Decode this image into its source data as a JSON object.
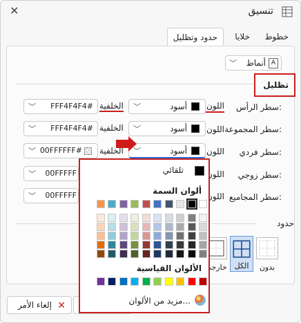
{
  "window": {
    "title": "تنسيق",
    "close": "✕"
  },
  "tabs": [
    {
      "label": "خطوط",
      "active": false
    },
    {
      "label": "خلايا",
      "active": false
    },
    {
      "label": "حدود وتظليل",
      "active": true
    }
  ],
  "styles_button": {
    "label": "أنماط"
  },
  "shading": {
    "title": "تظليل",
    "rows": [
      {
        "label": "سطر الرأس:",
        "color_label": "اللون",
        "color_value": "أسود",
        "bg_label": "الخلفية",
        "bg_value": "FFF4F4F4#"
      },
      {
        "label": "سطر المجموعة:",
        "color_label": "اللون",
        "color_value": "أسود",
        "bg_label": "الخلفية",
        "bg_value": "FFF4F4F4#"
      },
      {
        "label": "سطر فردي:",
        "color_label": "اللون",
        "color_value": "أسود",
        "bg_label": "الخلفية",
        "bg_value": "00FFFFFF#"
      },
      {
        "label": "سطر زوجي:",
        "color_label": "اللون",
        "color_value": "",
        "bg_label": "",
        "bg_value": "00FFFFF"
      },
      {
        "label": "سطر المجاميع:",
        "color_label": "اللون",
        "color_value": "",
        "bg_label": "",
        "bg_value": "00FFFFF"
      }
    ]
  },
  "borders": {
    "title": "حدود",
    "presets": [
      {
        "label": "بدون",
        "active": false
      },
      {
        "label": "الكل",
        "active": true
      },
      {
        "label": "خارجي",
        "active": false
      }
    ]
  },
  "buttons": {
    "cancel": "إلغاء الأمر"
  },
  "color_popup": {
    "automatic": "تلقائي",
    "theme_title": "ألوان السمة",
    "theme_top": [
      "#ffffff",
      "#000000",
      "#e7e6e6",
      "#44546a",
      "#4472c4",
      "#c0504d",
      "#9bbb59",
      "#8064a2",
      "#4bacc6",
      "#f79646"
    ],
    "theme_shades": [
      [
        "#f2f2f2",
        "#808080",
        "#d0cece",
        "#d6dce4",
        "#d9e2f3",
        "#f2dcdb",
        "#ebf1dd",
        "#e5e0ec",
        "#dbeef3",
        "#fde9d9"
      ],
      [
        "#d9d9d9",
        "#595959",
        "#aeaaaa",
        "#adb9ca",
        "#b4c6e7",
        "#e6b8b7",
        "#d7e3bc",
        "#ccc1d9",
        "#b7dde8",
        "#fbd5b5"
      ],
      [
        "#bfbfbf",
        "#404040",
        "#757171",
        "#8496b0",
        "#8eaadb",
        "#da9694",
        "#c3d69b",
        "#b2a2c7",
        "#92cddc",
        "#fac08f"
      ],
      [
        "#a6a6a6",
        "#262626",
        "#3a3838",
        "#323f4f",
        "#2f5496",
        "#953734",
        "#76923c",
        "#5f497a",
        "#31859b",
        "#e36c09"
      ],
      [
        "#808080",
        "#0d0d0d",
        "#171616",
        "#222a35",
        "#1f3864",
        "#632423",
        "#4f6128",
        "#3f3151",
        "#205867",
        "#974806"
      ]
    ],
    "standard_title": "الألوان القياسية",
    "standard": [
      "#c00000",
      "#ff0000",
      "#ffc000",
      "#ffff00",
      "#92d050",
      "#00b050",
      "#00b0f0",
      "#0070c0",
      "#002060",
      "#7030a0"
    ],
    "more": "مزيد من الألوان..."
  }
}
